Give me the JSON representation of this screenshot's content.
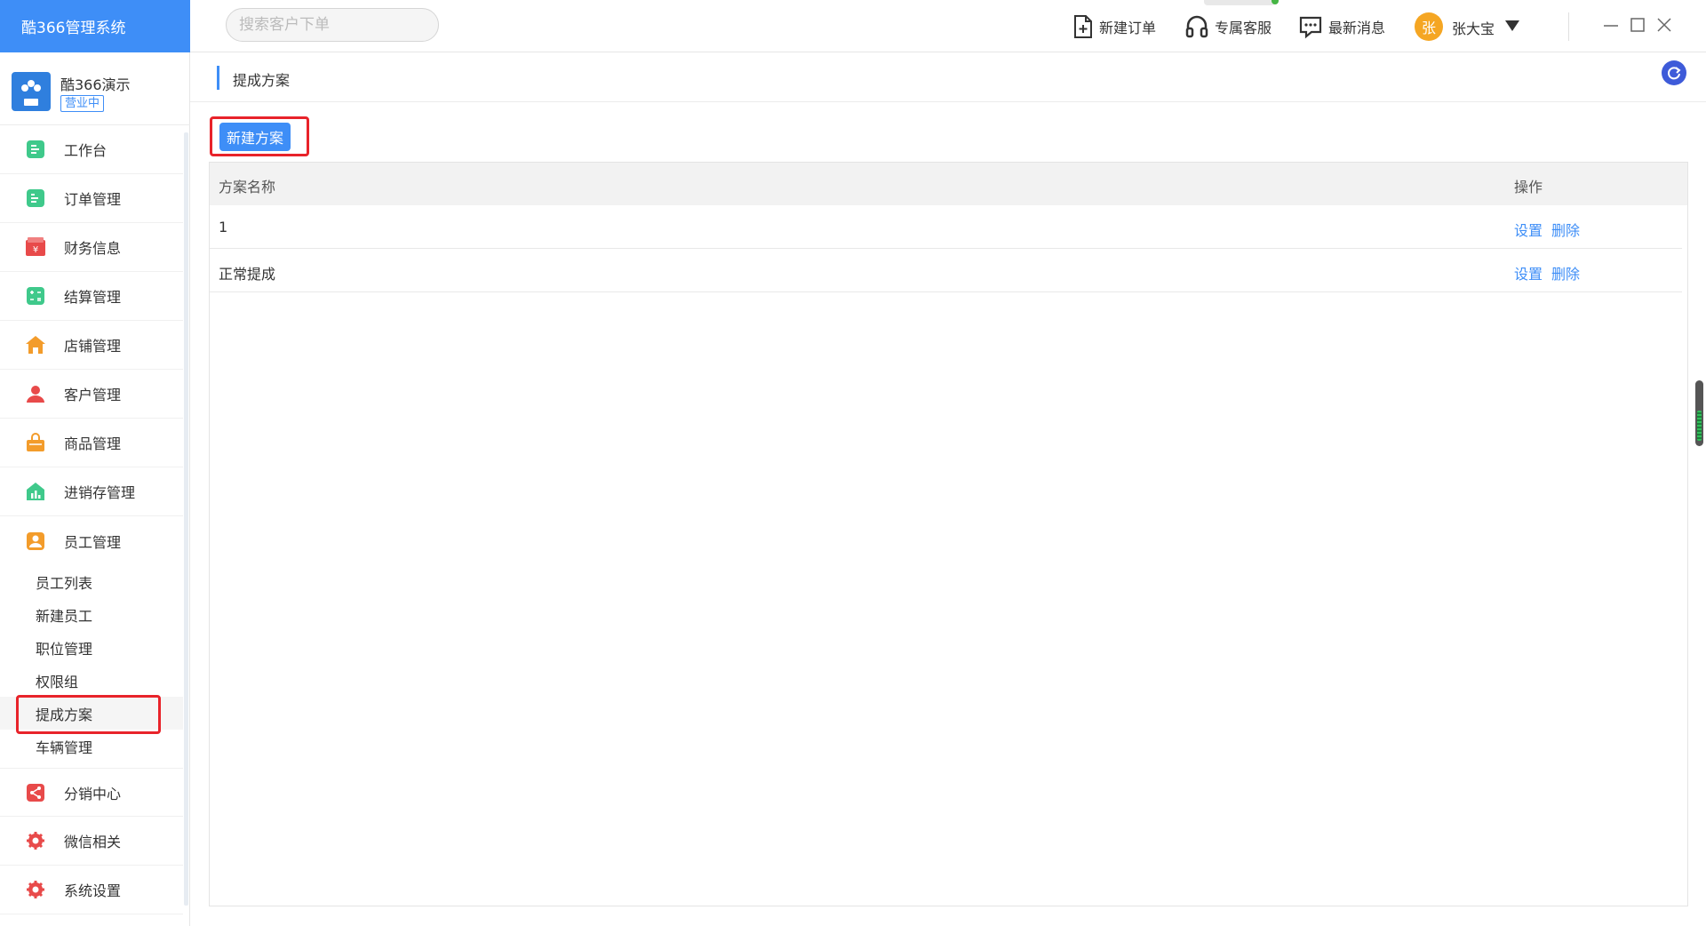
{
  "app": {
    "title": "酷366管理系统"
  },
  "search": {
    "placeholder": "搜索客户下单"
  },
  "header": {
    "actions": [
      {
        "label": "新建订单",
        "icon": "new-doc-icon"
      },
      {
        "label": "专属客服",
        "icon": "headset-icon"
      },
      {
        "label": "最新消息",
        "icon": "message-icon"
      }
    ],
    "user": {
      "avatar_char": "张",
      "name": "张大宝"
    }
  },
  "store": {
    "name": "酷366演示",
    "status": "营业中"
  },
  "sidebar": {
    "items": [
      {
        "label": "工作台",
        "icon": "workbench-icon",
        "color": "#3fc98b"
      },
      {
        "label": "订单管理",
        "icon": "order-icon",
        "color": "#3fc98b"
      },
      {
        "label": "财务信息",
        "icon": "finance-icon",
        "color": "#e84a4a"
      },
      {
        "label": "结算管理",
        "icon": "calculator-icon",
        "color": "#3fc98b"
      },
      {
        "label": "店铺管理",
        "icon": "store-icon",
        "color": "#f39c2b"
      },
      {
        "label": "客户管理",
        "icon": "customer-icon",
        "color": "#e84a4a"
      },
      {
        "label": "商品管理",
        "icon": "goods-bag-icon",
        "color": "#f39c2b"
      },
      {
        "label": "进销存管理",
        "icon": "inventory-icon",
        "color": "#3fc98b"
      },
      {
        "label": "员工管理",
        "icon": "staff-icon",
        "color": "#f39c2b"
      },
      {
        "label": "分销中心",
        "icon": "share-icon",
        "color": "#e84a4a"
      },
      {
        "label": "微信相关",
        "icon": "wechat-gear-icon",
        "color": "#e84a4a"
      },
      {
        "label": "系统设置",
        "icon": "settings-icon",
        "color": "#e84a4a"
      }
    ],
    "staff_sub": [
      "员工列表",
      "新建员工",
      "职位管理",
      "权限组",
      "提成方案",
      "车辆管理"
    ],
    "active_sub": "提成方案"
  },
  "breadcrumb": {
    "current": "提成方案"
  },
  "toolbar": {
    "new_plan": "新建方案"
  },
  "table": {
    "columns": [
      "方案名称",
      "操作"
    ],
    "rows": [
      {
        "name": "1",
        "ops": [
          "设置",
          "删除"
        ]
      },
      {
        "name": "正常提成",
        "ops": [
          "设置",
          "删除"
        ]
      }
    ]
  },
  "colors": {
    "brand": "#3e8ef7",
    "highlight": "#e8232a",
    "link": "#3e8ef7"
  }
}
